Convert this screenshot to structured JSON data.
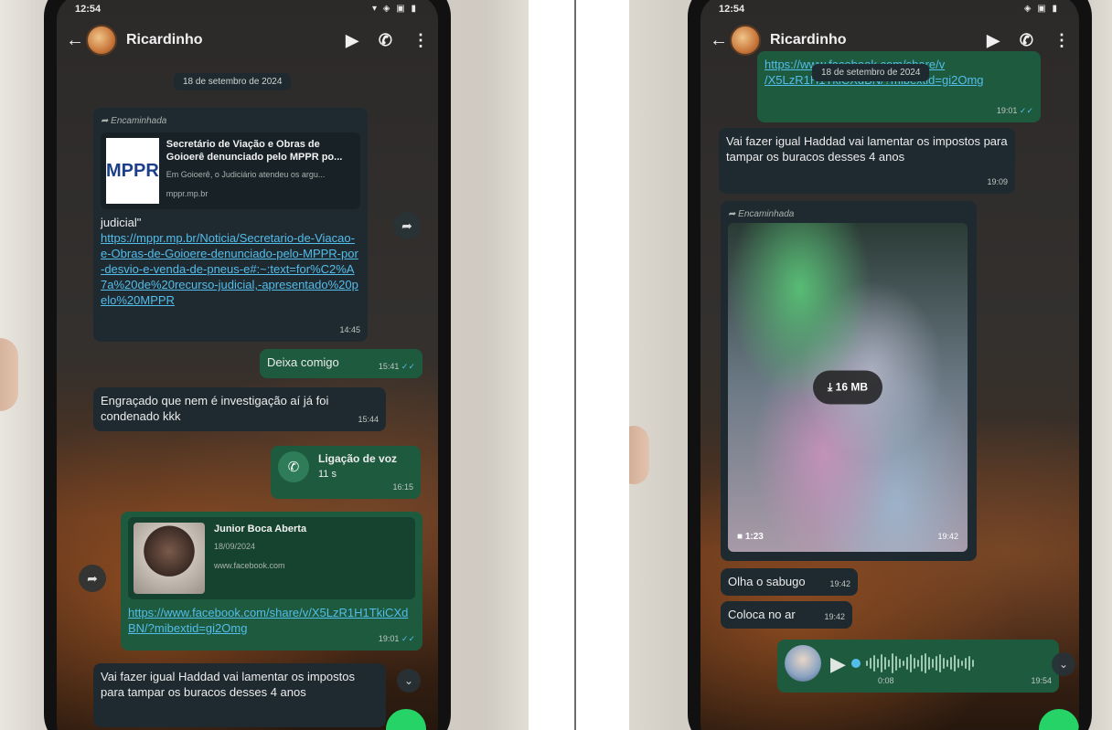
{
  "left": {
    "status_time": "12:54",
    "contact_name": "Ricardinho",
    "date_chip": "18 de setembro de 2024",
    "forwarded_label": "Encaminhada",
    "mppr": {
      "logo_text": "MPPR",
      "preview_title": "Secretário de Viação e Obras de Goioerê denunciado pelo MPPR po...",
      "preview_desc": "Em Goioerê, o Judiciário atendeu os argu...",
      "preview_domain": "mppr.mp.br",
      "text_prefix": "judicial\"",
      "link": "https://mppr.mp.br/Noticia/Secretario-de-Viacao-e-Obras-de-Goioere-denunciado-pelo-MPPR-por-desvio-e-venda-de-pneus-e#:~:text=for%C2%A7a%20de%20recurso-judicial,-apresentado%20pelo%20MPPR",
      "time": "14:45"
    },
    "msg_deixa": {
      "text": "Deixa comigo",
      "time": "15:41"
    },
    "msg_engracado": {
      "text": "Engraçado que nem é investigação aí já foi condenado kkk",
      "time": "15:44"
    },
    "voice_call": {
      "title": "Ligação de voz",
      "duration": "11 s",
      "time": "16:15"
    },
    "fb": {
      "title": "Junior Boca Aberta",
      "date": "18/09/2024",
      "domain": "www.facebook.com",
      "link": "https://www.facebook.com/share/v/X5LzR1H1TkiCXdBN/?mibextid=gi2Omg",
      "time": "19:01"
    },
    "msg_haddad": {
      "text": "Vai fazer igual Haddad vai lamentar os impostos para tampar os buracos desses 4 anos"
    }
  },
  "right": {
    "status_time": "12:54",
    "contact_name": "Ricardinho",
    "date_chip": "18 de setembro de 2024",
    "top_link_line1": "https://www.facebook.com/share/v",
    "top_link_line2": "/X5LzR1H1TkiCXdBN/?mibextid=gi2Omg",
    "top_time": "19:01",
    "msg_haddad": {
      "text": "Vai fazer igual Haddad vai lamentar os impostos para tampar os buracos desses 4 anos",
      "time": "19:09"
    },
    "forwarded_label": "Encaminhada",
    "video": {
      "size": "16 MB",
      "duration": "1:23",
      "time": "19:42"
    },
    "msg_sabugo": {
      "text": "Olha o sabugo",
      "time": "19:42"
    },
    "msg_coloca": {
      "text": "Coloca no ar",
      "time": "19:42"
    },
    "audio": {
      "duration": "0:08",
      "time": "19:54"
    }
  }
}
